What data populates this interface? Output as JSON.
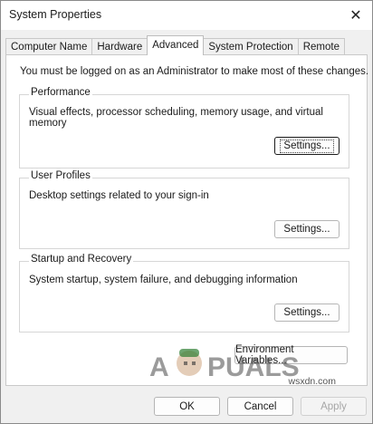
{
  "window": {
    "title": "System Properties",
    "close_symbol": "✕"
  },
  "tabs": [
    {
      "label": "Computer Name",
      "active": false
    },
    {
      "label": "Hardware",
      "active": false
    },
    {
      "label": "Advanced",
      "active": true
    },
    {
      "label": "System Protection",
      "active": false
    },
    {
      "label": "Remote",
      "active": false
    }
  ],
  "admin_note": "You must be logged on as an Administrator to make most of these changes.",
  "performance": {
    "title": "Performance",
    "description": "Visual effects, processor scheduling, memory usage, and virtual memory",
    "button": "Settings..."
  },
  "user_profiles": {
    "title": "User Profiles",
    "description": "Desktop settings related to your sign-in",
    "button": "Settings..."
  },
  "startup_recovery": {
    "title": "Startup and Recovery",
    "description": "System startup, system failure, and debugging information",
    "button": "Settings..."
  },
  "env_button": "Environment Variables...",
  "footer": {
    "ok": "OK",
    "cancel": "Cancel",
    "apply": "Apply"
  },
  "watermark": {
    "brand": "APPUALS",
    "site": "wsxdn.com"
  }
}
